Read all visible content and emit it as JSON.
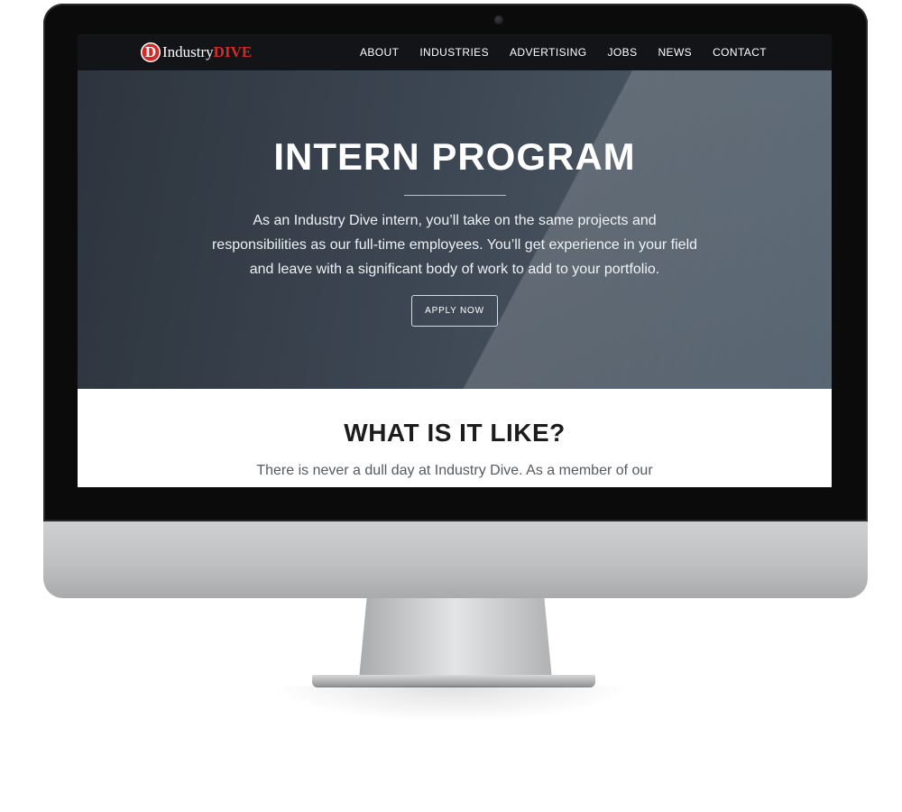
{
  "nav": {
    "logo": {
      "mark": "D",
      "text1": "Industry",
      "text2": "DIVE"
    },
    "items": [
      {
        "label": "ABOUT"
      },
      {
        "label": "INDUSTRIES"
      },
      {
        "label": "ADVERTISING"
      },
      {
        "label": "JOBS"
      },
      {
        "label": "NEWS"
      },
      {
        "label": "CONTACT"
      }
    ]
  },
  "hero": {
    "title": "INTERN PROGRAM",
    "text": "As an Industry Dive intern, you’ll take on the same projects and responsibilities as our full-time employees. You’ll get experience in your field and leave with a significant body of work to add to your portfolio.",
    "cta": "APPLY NOW"
  },
  "section": {
    "title": "WHAT IS IT LIKE?",
    "text": "There is never a dull day at Industry Dive. As a member of our"
  },
  "colors": {
    "brand_red": "#d42a27",
    "navbar": "#121417",
    "hero_dark": "#2d343d",
    "hero_light": "#52606d"
  }
}
